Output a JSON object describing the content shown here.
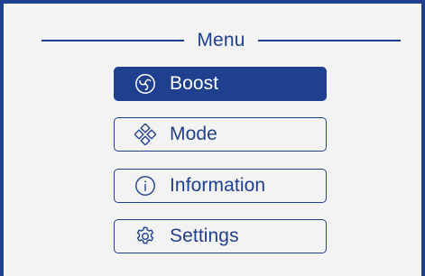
{
  "menu": {
    "title": "Menu",
    "items": [
      {
        "label": "Boost",
        "icon": "boost-icon",
        "active": true
      },
      {
        "label": "Mode",
        "icon": "mode-icon",
        "active": false
      },
      {
        "label": "Information",
        "icon": "info-icon",
        "active": false
      },
      {
        "label": "Settings",
        "icon": "gear-icon",
        "active": false
      }
    ]
  },
  "colors": {
    "accent": "#1f3f8f",
    "background": "#f3f3f3",
    "active_text": "#ffffff"
  }
}
